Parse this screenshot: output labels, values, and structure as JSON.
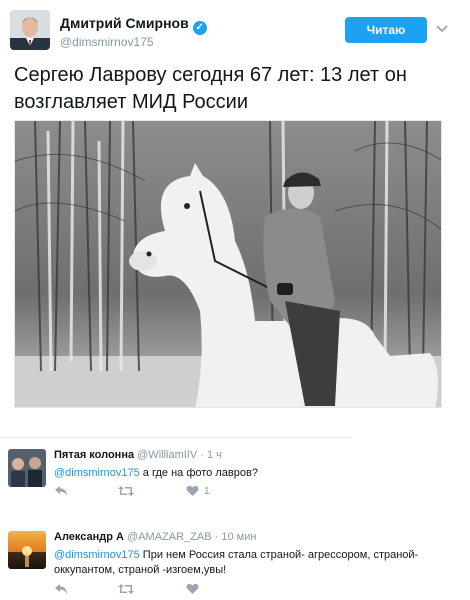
{
  "tweet": {
    "author_name": "Дмитрий Смирнов",
    "author_handle": "@dimsmirnov175",
    "follow_label": "Читаю",
    "text": "Сергею Лаврову сегодня 67 лет: 13 лет он возглавляет МИД России"
  },
  "replies": [
    {
      "name": "Пятая колонна",
      "handle": "@WilliamIIV",
      "time": "· 1 ч",
      "mention": "@dimsmirnov175",
      "text": " а где на фото лавров?",
      "like_count": "1"
    },
    {
      "name": "Александр А",
      "handle": "@AMAZAR_ZAB",
      "time": "· 10 мин",
      "mention": "@dimsmirnov175",
      "text": " При нем Россия стала страной- агрессором, страной-оккупантом, страной -изгоем,увы!",
      "like_count": ""
    }
  ],
  "colors": {
    "accent": "#1da1f2",
    "link": "#1b95e0",
    "muted": "#8899a6"
  },
  "icons": [
    "verified-badge-icon",
    "chevron-down-icon",
    "reply-icon",
    "retweet-icon",
    "like-icon"
  ]
}
